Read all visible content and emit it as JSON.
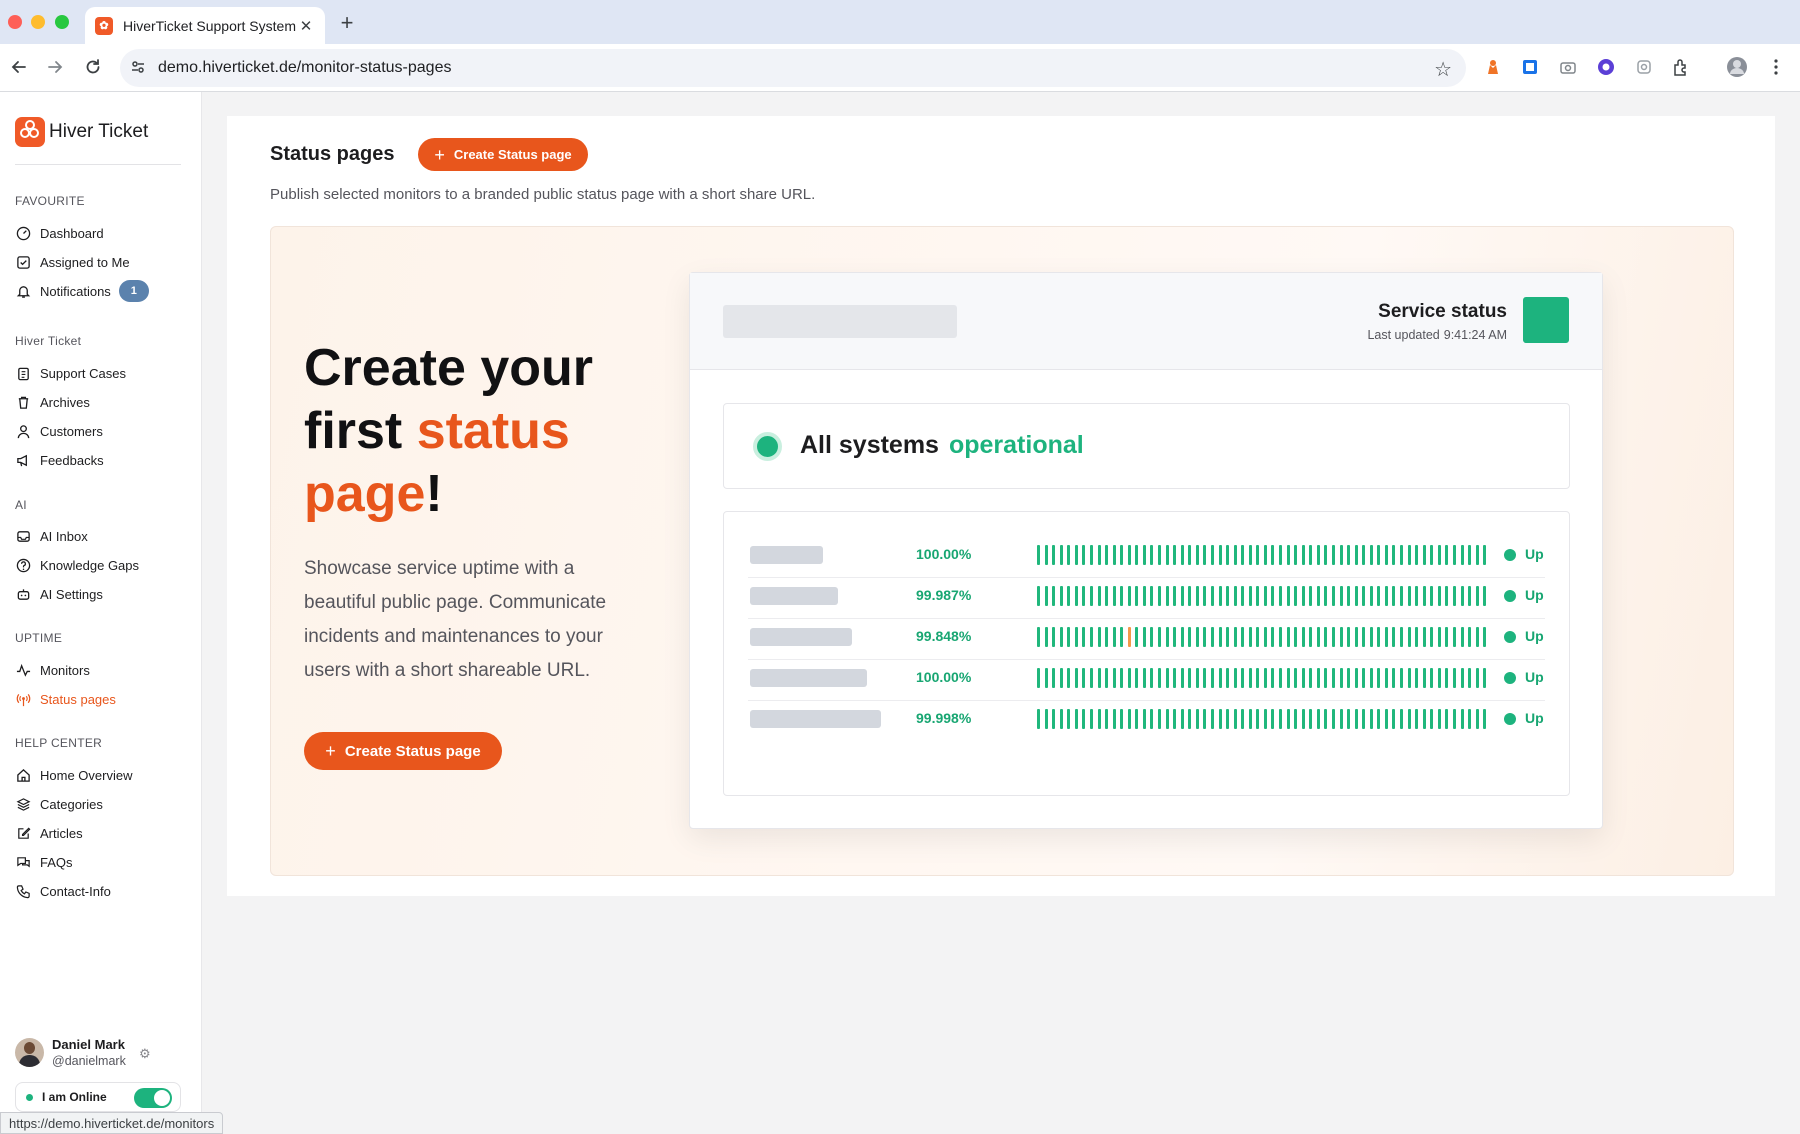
{
  "browser": {
    "tab_title": "HiverTicket Support System",
    "url": "demo.hiverticket.de/monitor-status-pages",
    "status_bar_url": "https://demo.hiverticket.de/monitors",
    "icons": [
      "back-icon",
      "forward-icon",
      "reload-icon",
      "site-settings-icon",
      "bookmark-star-icon",
      "extension-icon",
      "profile-avatar-icon",
      "menu-dots-icon"
    ]
  },
  "sidebar": {
    "brand": "Hiver Ticket",
    "sections": [
      {
        "label": "FAVOURITE",
        "items": [
          {
            "label": "Dashboard",
            "icon": "gauge-icon"
          },
          {
            "label": "Assigned to Me",
            "icon": "checkbox-icon"
          },
          {
            "label": "Notifications",
            "icon": "bell-icon",
            "badge": "1"
          }
        ]
      },
      {
        "label": "Hiver Ticket",
        "items": [
          {
            "label": "Support Cases",
            "icon": "clipboard-icon"
          },
          {
            "label": "Archives",
            "icon": "trash-icon"
          },
          {
            "label": "Customers",
            "icon": "user-icon"
          },
          {
            "label": "Feedbacks",
            "icon": "megaphone-icon"
          }
        ]
      },
      {
        "label": "AI",
        "items": [
          {
            "label": "AI Inbox",
            "icon": "inbox-icon"
          },
          {
            "label": "Knowledge Gaps",
            "icon": "help-circle-icon"
          },
          {
            "label": "AI Settings",
            "icon": "robot-icon"
          }
        ]
      },
      {
        "label": "UPTIME",
        "items": [
          {
            "label": "Monitors",
            "icon": "activity-icon"
          },
          {
            "label": "Status pages",
            "icon": "broadcast-icon",
            "active": true
          }
        ]
      },
      {
        "label": "HELP CENTER",
        "items": [
          {
            "label": "Home Overview",
            "icon": "home-icon"
          },
          {
            "label": "Categories",
            "icon": "layers-icon"
          },
          {
            "label": "Articles",
            "icon": "edit-icon"
          },
          {
            "label": "FAQs",
            "icon": "chat-icon"
          },
          {
            "label": "Contact-Info",
            "icon": "phone-icon"
          }
        ]
      }
    ],
    "user": {
      "name": "Daniel Mark",
      "handle": "@danielmark"
    },
    "online_label": "I am Online",
    "online": true
  },
  "main": {
    "title": "Status pages",
    "create_button": "Create Status page",
    "description": "Publish selected monitors to a branded public status page with a short share URL.",
    "hero": {
      "heading_part1": "Create your first ",
      "heading_accent": "status page",
      "heading_end": "!",
      "description": "Showcase service uptime with a beautiful public page. Communicate incidents and maintenances to your users with a short shareable URL.",
      "button": "Create Status page"
    },
    "preview": {
      "title": "Service status",
      "last_updated_label": "Last updated",
      "last_updated_time": "9:41:24 AM",
      "banner_text": "All systems",
      "banner_accent": "operational",
      "accent_color": "#1db37e",
      "rows": [
        {
          "uptime": "100.00%",
          "status": "Up",
          "warn_bar": -1
        },
        {
          "uptime": "99.987%",
          "status": "Up",
          "warn_bar": -1
        },
        {
          "uptime": "99.848%",
          "status": "Up",
          "warn_bar": 12
        },
        {
          "uptime": "100.00%",
          "status": "Up",
          "warn_bar": -1
        },
        {
          "uptime": "99.998%",
          "status": "Up",
          "warn_bar": -1
        }
      ]
    }
  },
  "colors": {
    "brand_orange": "#e8561c",
    "success_green": "#1db37e"
  }
}
